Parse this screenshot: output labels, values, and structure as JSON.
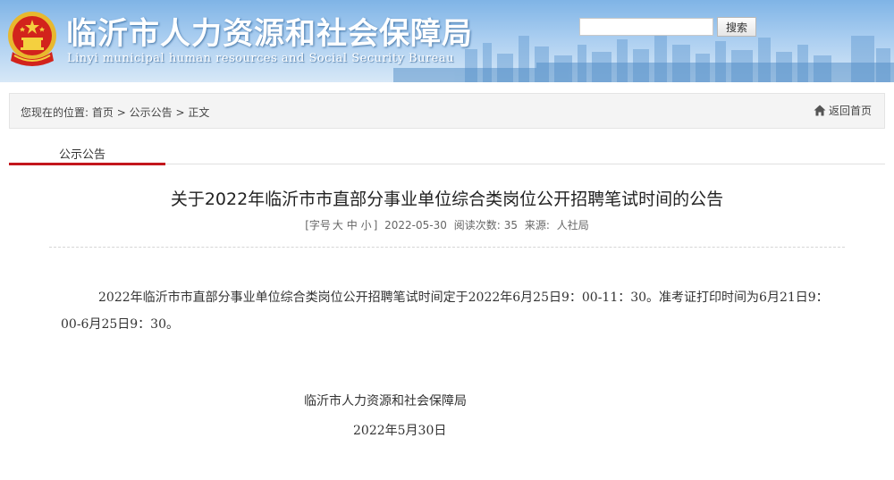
{
  "header": {
    "title": "临沂市人力资源和社会保障局",
    "subtitle": "Linyi municipal human resources and Social Security Bureau",
    "emblem_icon": "national-emblem-icon",
    "search": {
      "value": "",
      "button_label": "搜索"
    }
  },
  "breadcrumb": {
    "prefix": "您现在的位置:",
    "items": [
      "首页",
      "公示公告",
      "正文"
    ],
    "separator": ">",
    "home_link": "返回首页",
    "home_icon": "home-icon"
  },
  "section": {
    "tab_label": "公示公告",
    "accent_color": "#c3161c"
  },
  "article": {
    "title": "关于2022年临沂市市直部分事业单位综合类岗位公开招聘笔试时间的公告",
    "meta": {
      "font_prefix": "[字号",
      "font_large": "大",
      "font_medium": "中",
      "font_small": "小",
      "font_suffix": "]",
      "date": "2022-05-30",
      "views_label": "阅读次数:",
      "views": "35",
      "source_label": "来源:",
      "source": "人社局"
    },
    "body": "2022年临沂市市直部分事业单位综合类岗位公开招聘笔试时间定于2022年6月25日9：00-11：30。准考证打印时间为6月21日9：00-6月25日9：30。",
    "signature_org": "临沂市人力资源和社会保障局",
    "signature_date": "2022年5月30日"
  }
}
